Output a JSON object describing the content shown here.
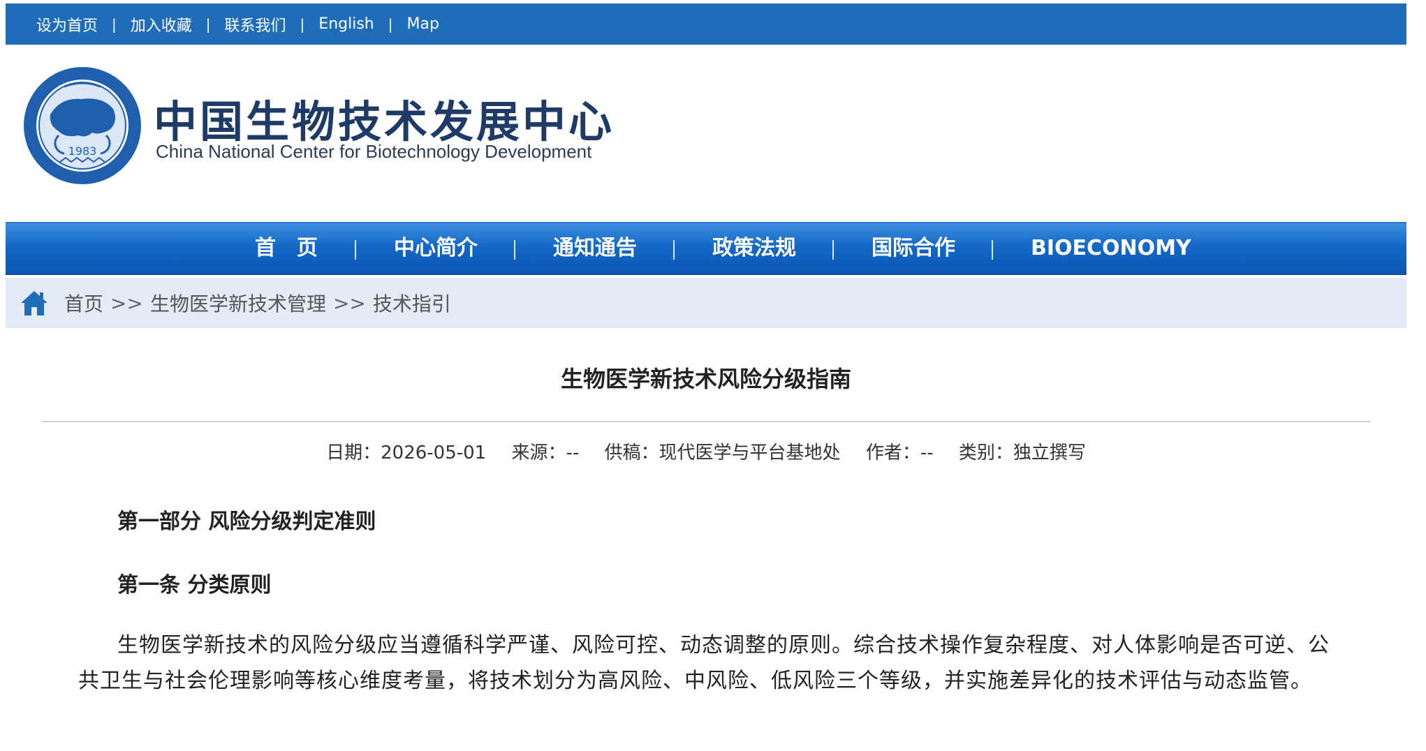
{
  "topbar": {
    "links": [
      "设为首页",
      "加入收藏",
      "联系我们",
      "English",
      "Map"
    ],
    "separator": "|"
  },
  "header": {
    "title_cn": "中国生物技术发展中心",
    "title_en": "China National Center for Biotechnology Development",
    "emblem_year": "1983"
  },
  "nav": {
    "items": [
      "首　页",
      "中心简介",
      "通知通告",
      "政策法规",
      "国际合作",
      "BIOECONOMY"
    ]
  },
  "breadcrumb": {
    "items": [
      "首页",
      "生物医学新技术管理",
      "技术指引"
    ],
    "arrow": ">>"
  },
  "article": {
    "title": "生物医学新技术风险分级指南",
    "meta": {
      "date": "日期：2026-05-01",
      "source": "来源：--",
      "contributor": "供稿：现代医学与平台基地处",
      "author": "作者：--",
      "category": "类别：独立撰写"
    },
    "part_heading": "第一部分 风险分级判定准则",
    "article_heading": "第一条 分类原则",
    "paragraph": "生物医学新技术的风险分级应当遵循科学严谨、风险可控、动态调整的原则。综合技术操作复杂程度、对人体影响是否可逆、公共卫生与社会伦理影响等核心维度考量，将技术划分为高风险、中风险、低风险三个等级，并实施差异化的技术评估与动态监管。"
  },
  "colors": {
    "topbar": "#1f6db9",
    "nav": "#1468c7",
    "breadcrumb_bg": "#e3ebf6",
    "logo_text": "#1e3a66"
  }
}
